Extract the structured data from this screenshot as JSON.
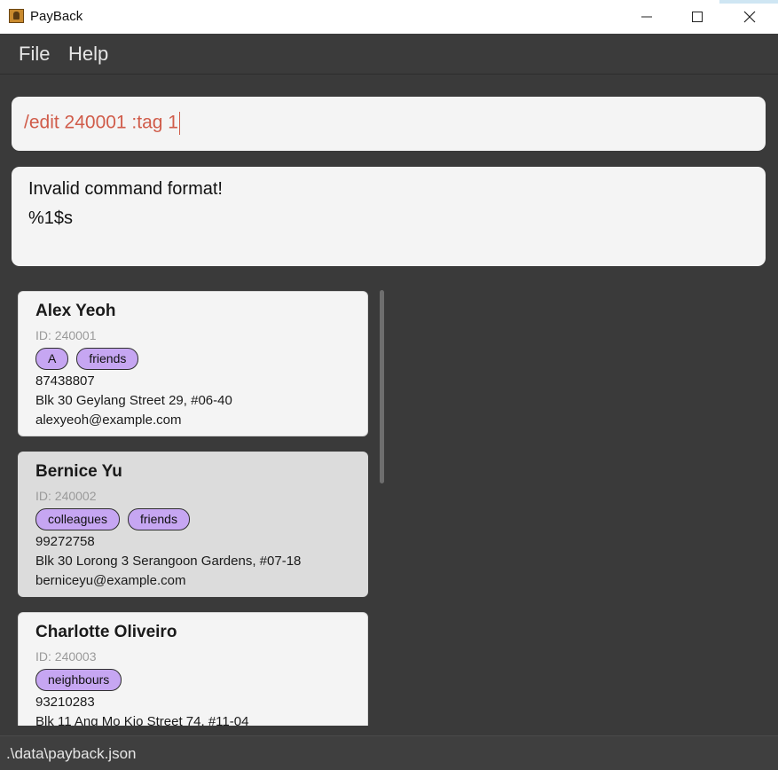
{
  "window": {
    "title": "PayBack",
    "icon": "address-book-icon"
  },
  "menu": {
    "file": "File",
    "help": "Help"
  },
  "command": {
    "value": "/edit 240001 :tag 1"
  },
  "result": {
    "line1": "Invalid command format!",
    "line2": "%1$s"
  },
  "persons": [
    {
      "name": "Alex Yeoh",
      "id": "ID: 240001",
      "tags": [
        "A",
        "friends"
      ],
      "phone": "87438807",
      "address": "Blk 30 Geylang Street 29, #06-40",
      "email": "alexyeoh@example.com",
      "selected": false
    },
    {
      "name": "Bernice Yu",
      "id": "ID: 240002",
      "tags": [
        "colleagues",
        "friends"
      ],
      "phone": "99272758",
      "address": "Blk 30 Lorong 3 Serangoon Gardens, #07-18",
      "email": "berniceyu@example.com",
      "selected": true
    },
    {
      "name": "Charlotte Oliveiro",
      "id": "ID: 240003",
      "tags": [
        "neighbours"
      ],
      "phone": "93210283",
      "address": "Blk 11 Ang Mo Kio Street 74, #11-04",
      "email": "",
      "selected": false
    }
  ],
  "status": {
    "path": ".\\data\\payback.json"
  },
  "colors": {
    "command_text": "#d05c4a",
    "tag_background": "#c6a6f2",
    "background": "#3a3a3a"
  }
}
